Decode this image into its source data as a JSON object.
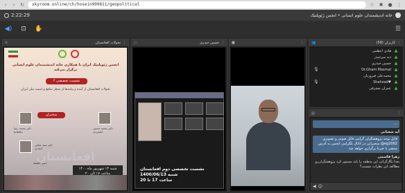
{
  "browser": {
    "url": "skyroom.online/ch/hosein999811/geopolitical"
  },
  "app": {
    "timer": "2:22:29",
    "room_title": "خانه اندیشمندان علوم انسانی • انجمن ژئوپلتیک"
  },
  "pods": {
    "poster": {
      "title": "تحولات افغانستان",
      "close": "×",
      "menu": "⋮"
    },
    "screen": {
      "title": "حسین حیدری",
      "menu": "⋮"
    },
    "video": {
      "title": "",
      "menu": "⋮"
    },
    "attendees": {
      "title": "کاربران (58)",
      "menu": "⋮"
    },
    "chat": {
      "title": "",
      "menu": "⋮"
    }
  },
  "poster": {
    "headline": "انجمن ژئوپلتیک ایران با همکاری خانه اندیشمندان علوم انسانی برگزار می‌کند",
    "banner": "نشست تخصصی ۲",
    "subtitle": "تحولات افغانستان از آینده و پیامدها از منظر منافع و امنیت ملی ایران",
    "speakers_label": "سخنران",
    "big_word": "افغانستان",
    "note": "دبیر جلسه",
    "date_line1": "شنبه ۱۳ شهریور ماه ۱۴۰۰",
    "date_line2": "ساعت ۱۷ الی ۲۰",
    "speaker1_caption": "دکتر محمد رضا حافظ‌نیا",
    "speaker2_caption": "دکتر محمد حسین افشردی",
    "speaker3_caption": "دکتر سید عباس احمدی"
  },
  "screen": {
    "caption_line1": "نشست تخصصی دوم افغانستان",
    "caption_line2": "شنبه 1400/06/13",
    "caption_line3": "ساعت 17 تا 20"
  },
  "attendees": [
    {
      "name": "هادی اعظمی",
      "mic": false
    },
    {
      "name": "دیه میرحیدر",
      "mic": false
    },
    {
      "name": "حسین حیدری",
      "mic": false
    },
    {
      "name": "Dr.Gham Masmal",
      "mic": true
    },
    {
      "name": "محمدعلی فیروزیان",
      "mic": false
    },
    {
      "name": "Shahzad♥",
      "mic": true
    },
    {
      "name": "عمران مشرقی",
      "mic": false
    }
  ],
  "chat": [
    {
      "who": "",
      "text": "..."
    },
    {
      "who": "آیه شعبانی",
      "text": "قابل توجه پژوهشگران گرامی فایل صوتی و تصویری سخنرانی در کانال تلگرامی انجمن به آدرس @eg2002 منتشر با خبرنا برگزاری خواهد شد"
    },
    {
      "who": "زهرا قاسمی",
      "text": "بعدا نگارگرانی این منطقه را باید مستور کرد پژوهشگران‌رو مطالعه این نظرات چیست؟"
    }
  ],
  "chat_input_placeholder": ""
}
